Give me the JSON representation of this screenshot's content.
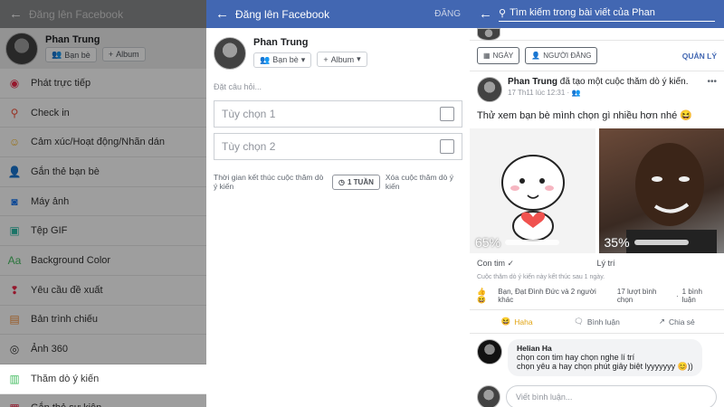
{
  "p1": {
    "header_title": "Đăng lên Facebook",
    "user_name": "Phan Trung",
    "audience": "Bạn bè",
    "album": "Album",
    "items": [
      {
        "label": "Phát trực tiếp",
        "icon": "live-video-icon",
        "glyph": "◉",
        "color": "#f02849"
      },
      {
        "label": "Check in",
        "icon": "location-pin-icon",
        "glyph": "⚲",
        "color": "#f5533d"
      },
      {
        "label": "Cảm xúc/Hoạt động/Nhãn dán",
        "icon": "smiley-icon",
        "glyph": "☺",
        "color": "#f7b928"
      },
      {
        "label": "Gắn thẻ bạn bè",
        "icon": "tag-friends-icon",
        "glyph": "👤",
        "color": "#1877f2"
      },
      {
        "label": "Máy ảnh",
        "icon": "camera-icon",
        "glyph": "◙",
        "color": "#1877f2"
      },
      {
        "label": "Tệp GIF",
        "icon": "gif-icon",
        "glyph": "▣",
        "color": "#2abba7"
      },
      {
        "label": "Background Color",
        "icon": "background-color-icon",
        "glyph": "Aa",
        "color": "#45bd62"
      },
      {
        "label": "Yêu cầu đề xuất",
        "icon": "recommendation-icon",
        "glyph": "❢",
        "color": "#f02849"
      },
      {
        "label": "Bản trình chiếu",
        "icon": "slideshow-icon",
        "glyph": "▤",
        "color": "#f7923b"
      },
      {
        "label": "Ảnh 360",
        "icon": "photo-360-icon",
        "glyph": "◎",
        "color": "#333"
      },
      {
        "label": "Thăm dò ý kiến",
        "icon": "poll-icon",
        "glyph": "▥",
        "color": "#45bd62"
      },
      {
        "label": "Gắn thẻ sự kiện",
        "icon": "calendar-icon",
        "glyph": "▦",
        "color": "#f02849"
      }
    ]
  },
  "p2": {
    "title": "Đăng lên Facebook",
    "post_action": "ĐĂNG",
    "user_name": "Phan Trung",
    "audience": "Bạn bè",
    "album": "Album",
    "ask_placeholder": "Đặt câu hỏi...",
    "option1": "Tùy chọn 1",
    "option2": "Tùy chọn 2",
    "end_label": "Thời gian kết thúc cuộc thăm dò ý kiến",
    "duration": "1 TUẦN",
    "remove_label": "Xóa cuộc thăm dò ý kiến"
  },
  "p3": {
    "search": "Tìm kiếm trong bài viết của Phan",
    "filter_day": "NGÀY",
    "filter_poster": "NGƯỜI ĐĂNG",
    "manage": "QUẢN LÝ",
    "author": "Phan Trung",
    "action_text": "đã tạo một cuộc thăm dò ý kiến.",
    "time": "17 Th11 lúc 12:31 ·",
    "text": "Thử xem bạn bè mình chọn gì nhiều hơn nhé 😆",
    "poll": [
      {
        "label": "Con tim",
        "percent": 65,
        "percent_text": "65%"
      },
      {
        "label": "Lý trí",
        "percent": 35,
        "percent_text": "35%"
      }
    ],
    "poll_end": "Cuộc thăm dò ý kiến này kết thúc sau 1 ngày.",
    "reactions": "Bạn, Đạt Đình Đức và 2 người khác",
    "votes": "17 lượt bình chọn",
    "comments_count": "1 bình luận",
    "haha": "Haha",
    "comment_btn": "Bình luận",
    "share_btn": "Chia sẻ",
    "commenter": "Helian Ha",
    "comment_line1": "chọn con tim hay chọn nghe lí trí",
    "comment_line2": "chọn yêu a hay chọn phút giây biệt lyyyyyyy 😊))",
    "write_placeholder": "Viết bình luận..."
  }
}
